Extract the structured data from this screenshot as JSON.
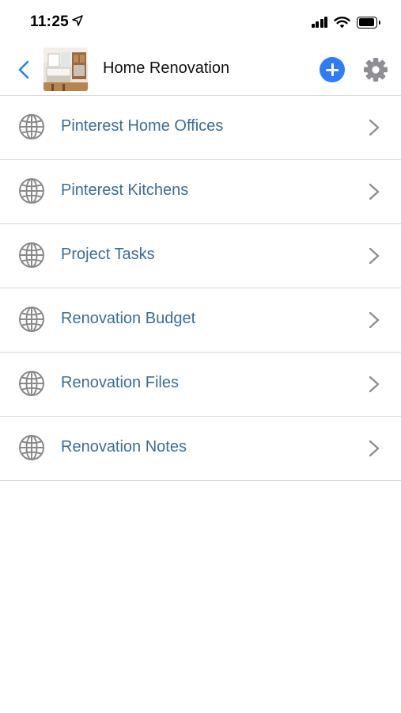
{
  "status_bar": {
    "time": "11:25",
    "icons": [
      "location-arrow-icon",
      "signal-icon",
      "wifi-icon",
      "battery-icon"
    ]
  },
  "nav": {
    "back_icon": "chevron-left-icon",
    "title": "Home Renovation",
    "add_icon": "plus-circle-icon",
    "settings_icon": "gear-icon",
    "accent_color": "#2f7cf6"
  },
  "list": {
    "item_icon": "globe-icon",
    "trailing_icon": "chevron-right-icon",
    "text_color": "#3b6d98",
    "items": [
      {
        "label": "Pinterest Home Offices"
      },
      {
        "label": "Pinterest Kitchens"
      },
      {
        "label": "Project Tasks"
      },
      {
        "label": "Renovation Budget"
      },
      {
        "label": "Renovation Files"
      },
      {
        "label": "Renovation Notes"
      }
    ]
  }
}
